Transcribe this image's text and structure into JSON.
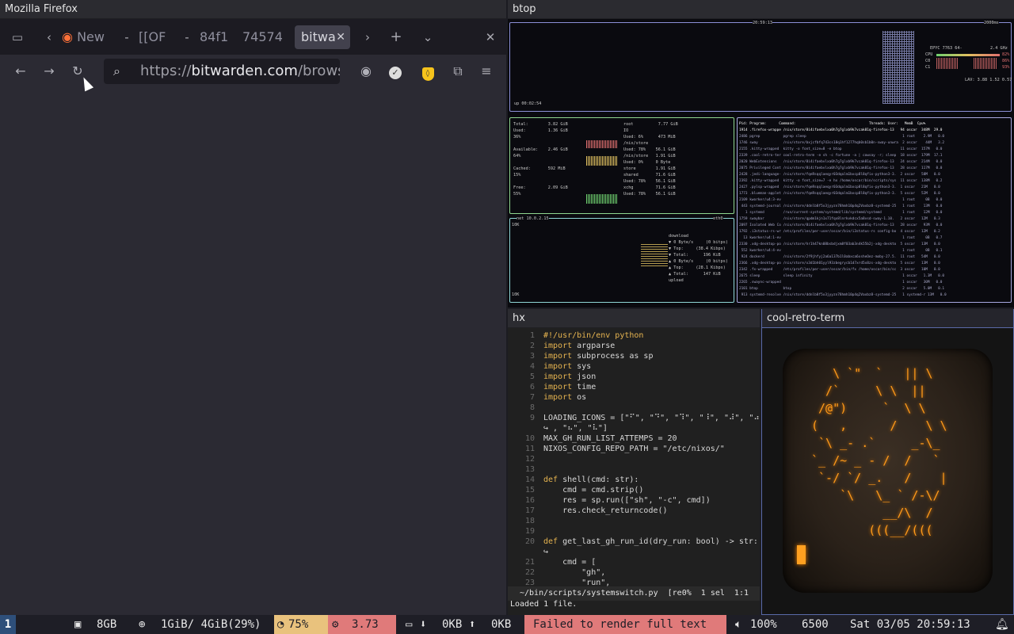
{
  "firefox": {
    "title": "Mozilla Firefox",
    "tabs": [
      "New",
      "[[OF",
      "84f1",
      "74574",
      "bitwa"
    ],
    "url_prefix": "https://",
    "url_host": "bitwarden.com",
    "url_rest": "/browse"
  },
  "btop": {
    "title": "btop",
    "cpu": {
      "clock": "20:59:13",
      "interval": "2000ms",
      "uptime": "up 00:02:54",
      "model": "EPYC 7763 64-",
      "freq": "2.4 GHz",
      "lav": "LAV: 3.88 1.52 0.57",
      "rows": [
        "CPU",
        "C0",
        "C1"
      ],
      "pcts": [
        "82%",
        "86%",
        "93%"
      ]
    },
    "mem": {
      "lines": [
        "Total:        3.82 GiB",
        "Used:         1.36 GiB",
        "36%",
        "Available:    2.46 GiB",
        "64%",
        "Cached:       592 MiB",
        "15%",
        "Free:         2.09 GiB",
        "55%"
      ]
    },
    "disks": {
      "lines": [
        "root          7.77 GiB",
        "IO",
        "Used: 6%      473 MiB",
        "/nix/store",
        "Used: 78%    56.1 GiB",
        "/nix/store   1.91 GiB",
        "Used: 0%     0 Byte",
        "store        1.91 GiB",
        "shared       71.6 GiB",
        "Used: 78%    56.1 GiB",
        "xchg         71.6 GiB",
        "Used: 78%    56.1 GiB"
      ]
    },
    "net": {
      "label": "net 10.0.2.15",
      "iface": "eth0",
      "scale": "10K",
      "lines": [
        "download",
        "▼ 0 Byte/s     (0 bitps)",
        "▼ Top:     (38.4 Kibps)",
        "▼ Total:      196 KiB",
        "",
        "▲ 0 Byte/s     (0 bitps)",
        "▲ Top:     (28.1 Kibps)",
        "▲ Total:      147 KiB",
        "upload"
      ]
    },
    "proc": {
      "header": "Pid: Program:      Command:                                   Threads: User:   MemB  Cpu%",
      "rows": [
        "1914 .firefox-wrappe /nix/store/8i4ifaebvlxa0h7g7glxb9k7vcak81q-firefox-13   94 oscar  348M  29.0",
        "2486 pgrep           pgrep sleep                                              1 root    2.9M   0.0",
        "1746 sway            /nix/store/bxjcfbfq743cs18q1hf1277hqb0sb1b0n-sway-unwra  2 oscar    44M   3.2",
        "2155 .kitty-wrapped  kitty -o font_size=8 -e btop                            11 oscar  157M   0.0",
        "2339 .cool-retro-ter cool-retro-term -e sh -c fortune -a | cowsay -r; sleep  18 oscar  179M  17.1",
        "2020 WebExtensions   /nix/store/8i4ifaebvlxa0h7g7glxb9k7vcak81q-firefox-13   24 oscar  214M   0.0",
        "2075 Privileged Cont /nix/store/8i4ifaebvlxa0h7g7glxb9k7vcak81q-firefox-13   28 oscar  117M   0.0",
        "2428 .jedi-language- /nix/store/fqeRsqqlaeqyr03dqalm1bxcp8l8qfix-python3-3.  2 oscar   58M   0.0",
        "2392 .kitty-wrapped  kitty -o font_size=7 -e hx /home/oscar/bin/scripts/sys  11 oscar  138M   0.2",
        "2427 .pylsp-wrapped  /nix/store/fqeRsqqlaeqyr03dqalm1bxcp8l8qfix-python3-3.  1 oscar   21M   0.0",
        "1773 .blueman-applet /nix/store/fqeRsqqlaeqyr03dqalm1bxcp8l8qfix-python3-3.  5 oscar   52M   0.0",
        "2109 kworker/u4:3-ev                                                          1 root     0B   0.0",
        " 443 systemd-journal /nix/store/ddnlb8f5x3jyyzn78hmh10p4q2Vaxbz8-systemd-25   1 root    13M   0.0",
        "   1 systemd         /run/current-system/systemd/lib/systemd/systemd          1 root    12M   0.0",
        "1759 swaybar         /nix/store/qpdm1kjn1x71fqx8lnrkvkdcx5a8vsd-sway-1.10.   2 oscar   12M   0.3",
        "2097 Isolated Web Co /nix/store/8i4ifaebvlxa0h7g7glxb9k7vcak81q-firefox-13   28 oscar   93M   0.0",
        "1792 .i3status-rs-wr /etc/profiles/per-user/oscar/bin/i3status-rs config-bo  4 oscar   12M   0.2",
        "  13 kworker/u4:1-ev                                                          1 root     0B   0.7",
        "2330 .xdg-desktop-po /nix/store/hr1h47kn08bsbdjxm8f03ab3n4k55b2j-xdg-deskto  5 oscar   13M   0.0",
        " 552 kworker/u4:4-ev                                                          1 root     0B   0.1",
        " 924 dockerd         /nix/store/2f9jhfyj2a6a137b1l0abxca6xsheOez-moby-27.5.  11 root   54M   0.0",
        "2366 .xdg-desktop-po /nix/store/x3d1bh01yyl93zbegrycb1d7xrd5x8zs-xdg-deskto  5 oscar   13M   0.0",
        "2342 .fx-wrapped     /etc/profiles/per-user/oscar/bin/fx /home/oscar/bin/sc  3 oscar   10M   0.0",
        "2675 sleep           sleep infinity                                           1 oscar   1.3M   0.0",
        "2265 .swaync-wrapped                                                          1 oscar   30M   0.0",
        "2101 btop            btop                                                     2 oscar   5.0M   0.1",
        " 913 systemd-resolve /nix/store/ddnlb8f5x3jyyzn78hmh10p4q2Vaxbz8-systemd-25   1 systemd-r 13M   0.0"
      ]
    }
  },
  "hx": {
    "title": "hx",
    "lines": [
      {
        "n": "1",
        "t": "#!/usr/bin/env python",
        "k": "cm"
      },
      {
        "n": "2",
        "t": "import argparse",
        "k": "imp"
      },
      {
        "n": "3",
        "t": "import subprocess as sp",
        "k": "imp"
      },
      {
        "n": "4",
        "t": "import sys",
        "k": "imp"
      },
      {
        "n": "5",
        "t": "import json",
        "k": "imp"
      },
      {
        "n": "6",
        "t": "import time",
        "k": "imp"
      },
      {
        "n": "7",
        "t": "import os",
        "k": "imp"
      },
      {
        "n": "8",
        "t": "",
        "k": ""
      },
      {
        "n": "9",
        "t": "LOADING_ICONS = [\"⠋\", \"⠙\", \"⠹\", \"⠸\", \"⠼\", \"⠴\"",
        "k": "plain"
      },
      {
        "n": "",
        "t": "↪ , \"⠦\", \"⠧\"]",
        "k": "plain"
      },
      {
        "n": "10",
        "t": "MAX_GH_RUN_LIST_ATTEMPS = 20",
        "k": "plain"
      },
      {
        "n": "11",
        "t": "NIXOS_CONFIG_REPO_PATH = \"/etc/nixos/\"",
        "k": "plain"
      },
      {
        "n": "12",
        "t": "",
        "k": ""
      },
      {
        "n": "13",
        "t": "",
        "k": ""
      },
      {
        "n": "14",
        "t": "def shell(cmd: str):",
        "k": "def"
      },
      {
        "n": "15",
        "t": "    cmd = cmd.strip()",
        "k": "plain"
      },
      {
        "n": "16",
        "t": "    res = sp.run([\"sh\", \"-c\", cmd])",
        "k": "plain"
      },
      {
        "n": "17",
        "t": "    res.check_returncode()",
        "k": "plain"
      },
      {
        "n": "18",
        "t": "",
        "k": ""
      },
      {
        "n": "19",
        "t": "",
        "k": ""
      },
      {
        "n": "20",
        "t": "def get_last_gh_run_id(dry_run: bool) -> str:",
        "k": "def"
      },
      {
        "n": "",
        "t": "↪",
        "k": "plain"
      },
      {
        "n": "21",
        "t": "    cmd = [",
        "k": "plain"
      },
      {
        "n": "22",
        "t": "        \"gh\",",
        "k": "plain"
      },
      {
        "n": "23",
        "t": "        \"run\",",
        "k": "plain"
      }
    ],
    "status": "~/bin/scripts/systemswitch.py  [re0%  1 sel  1:1",
    "message": "Loaded 1 file."
  },
  "crt": {
    "title": "cool-retro-term",
    "art": "   \\ `\"  `   || \\\n  /`     \\ \\  ||\n /@\")     `  \\ \\\n(   ,      /    \\ \\\n `\\ _- .`     _-\\_\n`_ /~ _ - /  /   `\n `-/ `/ _.   /    |\n    `\\   \\_ ` /-\\/\n          __/\\  /\n        (((__/((("
  },
  "statusbar": {
    "workspace": "1",
    "ram": "8GB",
    "mem": "1GiB/ 4GiB(29%)",
    "cpu": "75%",
    "load": "3.73",
    "net_down": "0KB",
    "net_up": "0KB",
    "error": "Failed to render full text",
    "volume": "100%",
    "brightness": "6500",
    "datetime": "Sat 03/05 20:59:13"
  }
}
